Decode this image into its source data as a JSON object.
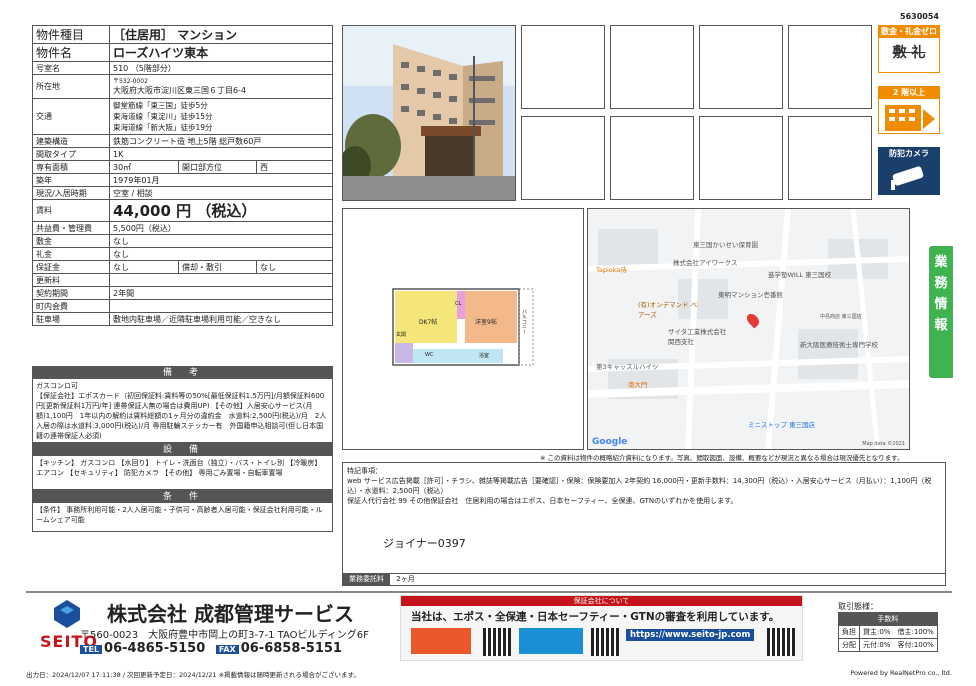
{
  "doc_id": "5630054",
  "property": {
    "rows": [
      {
        "k": "物件種目",
        "v": "［住居用］ マンション"
      },
      {
        "k": "物件名",
        "v": "ローズハイツ東本"
      },
      {
        "k": "号室名",
        "v": "510 （5階部分）"
      },
      {
        "k": "所在地",
        "v_small": "〒532-0002",
        "v": "大阪府大阪市淀川区東三国６丁目6-4"
      },
      {
        "k": "交通",
        "lines": [
          "御堂筋線「東三国」徒歩5分",
          "東海道線「東淀川」徒歩15分",
          "東海道線「新大阪」徒歩19分"
        ]
      },
      {
        "k": "建築構造",
        "v": "鉄筋コンクリート造 地上5階 総戸数60戸"
      },
      {
        "k": "間取タイプ",
        "v": "1K"
      },
      {
        "k": "専有面積",
        "v": "30㎡",
        "k2": "開口部方位",
        "v2": "西"
      },
      {
        "k": "築年",
        "v": "1979年01月"
      },
      {
        "k": "現況/入居時期",
        "v": "空室 / 相談"
      },
      {
        "k": "賃料",
        "v": "44,000 円 （税込）"
      },
      {
        "k": "共益費・管理費",
        "v": "5,500円（税込）"
      },
      {
        "k": "敷金",
        "v": "なし"
      },
      {
        "k": "礼金",
        "v": "なし"
      },
      {
        "k": "保証金",
        "v": "なし",
        "k2": "償却・敷引",
        "v2": "なし"
      },
      {
        "k": "更新料",
        "v": ""
      },
      {
        "k": "契約期間",
        "v": "2年間"
      },
      {
        "k": "町内会費",
        "v": ""
      },
      {
        "k": "駐車場",
        "v": "敷地内駐車場／近隣駐車場利用可能／空きなし"
      }
    ]
  },
  "sections": {
    "remarks_head": "備　考",
    "remarks_body": "ガスコンロ可\n【保証会社】エポスカード（初回保証料:賃料等の50%[最低保証料1.5万円]/月額保証料600円[更新保証料1万円/年] 連帯保証人無の場合は費用UP) 【その他】入居安心サービス(月額)1,100円　1年以内の解約は賃料総額の1ヶ月分の違約金　水道料:2,500円(税込)/月　2人入居の際は水道料:3,000円(税込)/月 専用駐輪ステッカー有　外国籍申込相談可(但し日本国籍の連帯保証人必須)",
    "equip_head": "設　備",
    "equip_body": "【キッチン】 ガスコンロ 【水回り】 トイレ・洗面台（独立）・バス・トイレ別 【冷暖房】 エアコン 【セキュリティ】 防犯カメラ 【その他】 専用ごみ置場・自転車置場",
    "cond_head": "条　件",
    "cond_body": "【条件】 事務所利用可能・2人入居可能・子供可・高齢者入居可能・保証会社利用可能・ルームシェア可能"
  },
  "features": [
    {
      "title": "敷金・礼金ゼロ",
      "text": "敷 礼"
    },
    {
      "title": "2 階以上",
      "text": ""
    },
    {
      "title": "防犯カメラ",
      "text": ""
    }
  ],
  "floorplan": {
    "room1": "DK7帖",
    "room2": "洋室9帖",
    "balcony": "バルコニー",
    "entrance": "玄関",
    "wc": "WC",
    "bath": "浴室",
    "closet": "CL"
  },
  "map": {
    "labels": [
      "東三国かいせい保育園",
      "株式会社アイワークス",
      "Tapioka侍",
      "進学塾WILL 東三国校",
      "東明マンション壱番館",
      "(有)オンデマンド ベアーズ",
      "サイタ工業株式会社 関西支社",
      "新大阪医療技術士専門学校",
      "第3キャッスルハイツ",
      "南大門",
      "ミニストップ 東三国店",
      "中島商店 東三国店"
    ],
    "google": "Google",
    "copyright": "Map data ©2021"
  },
  "map_note": "※ この資料は物件の概略紹介資料になります。写真、間取図面、設備、概要などが現況と異なる場合は現況優先となります。",
  "remarks_box": {
    "head": "特記事項：",
    "body": "web サービス広告掲載［許可］・チラシ、雑誌等掲載広告［要確認］・保険：保険要加入 2年契約 16,000円・更新手数料：14,300円（税込）・入居安心サービス（月払い）：1,100円（税込）・水道料：2,500円（税込）\n保証人代行会社 99 その他保証会社　住居利用の場合はエポス、日本セーフティー、全保連、GTNのいずれかを使用します。",
    "code": "ジョイナー0397",
    "foot_label": "業務委託料",
    "foot_value": "2ヶ月"
  },
  "side_tab": "業務情報",
  "company": {
    "logo": "SEITO",
    "name": "株式会社 成都管理サービス",
    "address": "〒560-0023　大阪府豊中市岡上の町3-7-1 TAOビルディング6F",
    "tel_label": "TEL",
    "tel": "06-4865-5150",
    "fax_label": "FAX",
    "fax": "06-6858-5151"
  },
  "banner": {
    "top": "保証会社について",
    "main": "当社は、エポス・全保連・日本セーフティー・GTNの審査を利用しています。",
    "url": "https://www.seito-jp.com"
  },
  "trade": {
    "title": "取引態様：",
    "fee_label": "手数料",
    "rows": [
      {
        "k": "負担",
        "v": "貸主:0%　借主:100%"
      },
      {
        "k": "分配",
        "v": "元付:0%　客付:100%"
      }
    ]
  },
  "print_date": "出力日：2024/12/07 17:11:38 / 次回更新予定日：2024/12/21 ※掲載情報は随時更新される場合がございます。",
  "powered": "Powered by RealNetPro co., ltd."
}
